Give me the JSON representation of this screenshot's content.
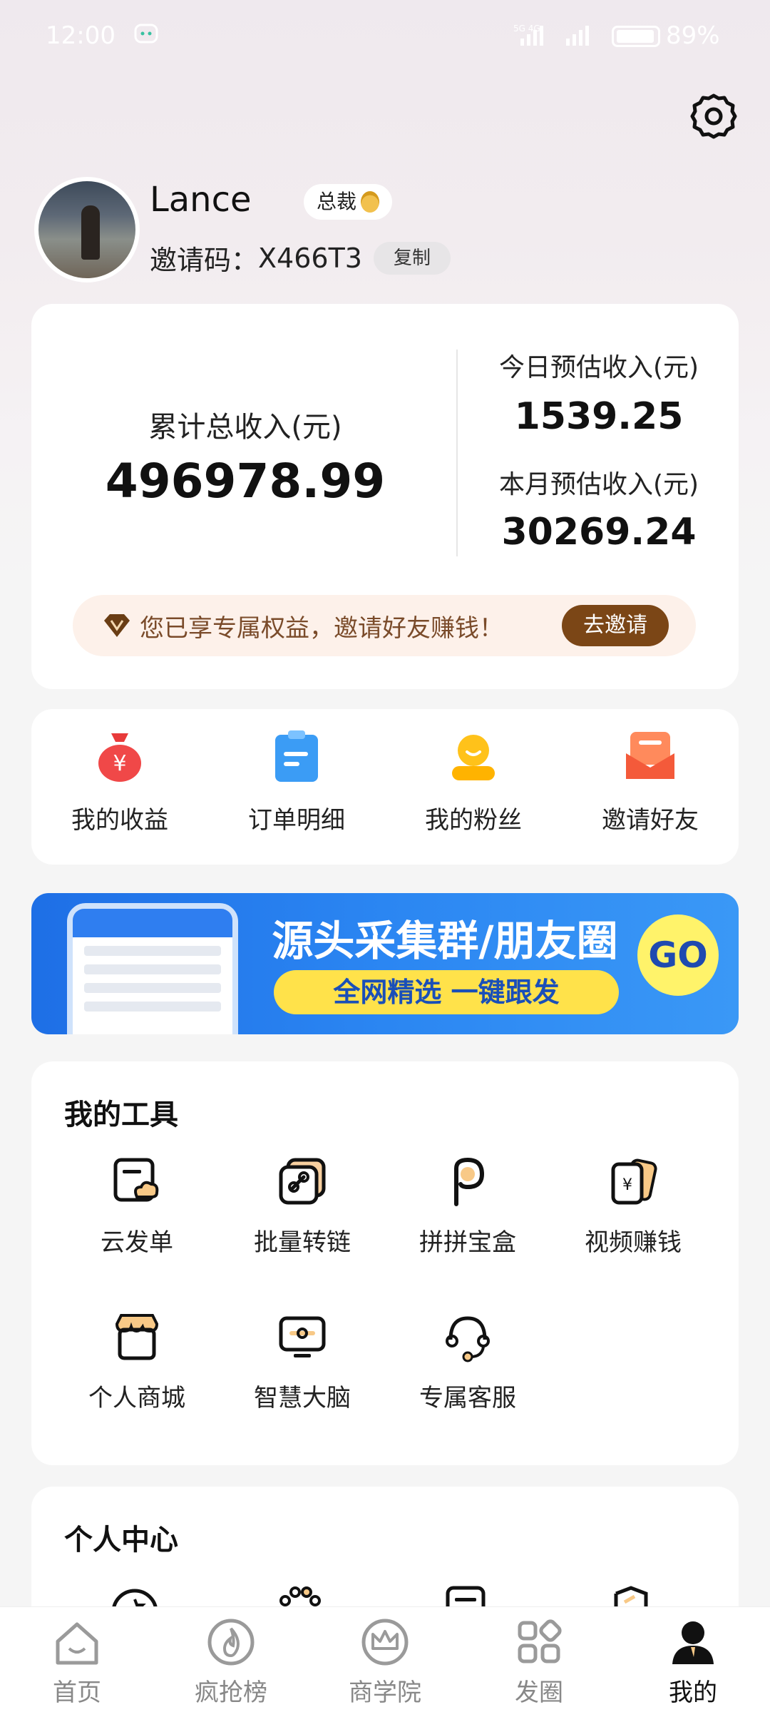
{
  "status_bar": {
    "time": "12:00",
    "network": "5G 4G",
    "battery": "89%"
  },
  "profile": {
    "name": "Lance",
    "badge": "总裁",
    "invite_label": "邀请码：",
    "invite_code": "X466T3",
    "copy_label": "复制"
  },
  "income": {
    "total_label": "累计总收入(元)",
    "total_value": "496978.99",
    "today_label": "今日预估收入(元)",
    "today_value": "1539.25",
    "month_label": "本月预估收入(元)",
    "month_value": "30269.24",
    "promo_text": "您已享专属权益，邀请好友赚钱！",
    "promo_button": "去邀请"
  },
  "quick_actions": [
    {
      "label": "我的收益",
      "icon": "money-bag-icon"
    },
    {
      "label": "订单明细",
      "icon": "clipboard-icon"
    },
    {
      "label": "我的粉丝",
      "icon": "fans-icon"
    },
    {
      "label": "邀请好友",
      "icon": "invite-envelope-icon"
    }
  ],
  "banner": {
    "title": "源头采集群/朋友圈",
    "subtitle": "全网精选  一键跟发",
    "go": "GO"
  },
  "tools": {
    "title": "我的工具",
    "items": [
      {
        "label": "云发单",
        "icon": "cloud-send-icon"
      },
      {
        "label": "批量转链",
        "icon": "batch-link-icon"
      },
      {
        "label": "拼拼宝盒",
        "icon": "pinpin-box-icon"
      },
      {
        "label": "视频赚钱",
        "icon": "video-money-icon"
      },
      {
        "label": "个人商城",
        "icon": "store-icon"
      },
      {
        "label": "智慧大脑",
        "icon": "smart-brain-icon"
      },
      {
        "label": "专属客服",
        "icon": "headset-icon"
      }
    ]
  },
  "personal_center": {
    "title": "个人中心"
  },
  "tabbar": [
    {
      "label": "首页",
      "icon": "home-icon"
    },
    {
      "label": "疯抢榜",
      "icon": "fire-icon"
    },
    {
      "label": "商学院",
      "icon": "crown-icon"
    },
    {
      "label": "发圈",
      "icon": "grid-icon"
    },
    {
      "label": "我的",
      "icon": "user-icon"
    }
  ],
  "colors": {
    "accent_brown": "#7b4616",
    "banner_blue": "#2b86f2",
    "banner_yellow": "#ffe24a"
  }
}
